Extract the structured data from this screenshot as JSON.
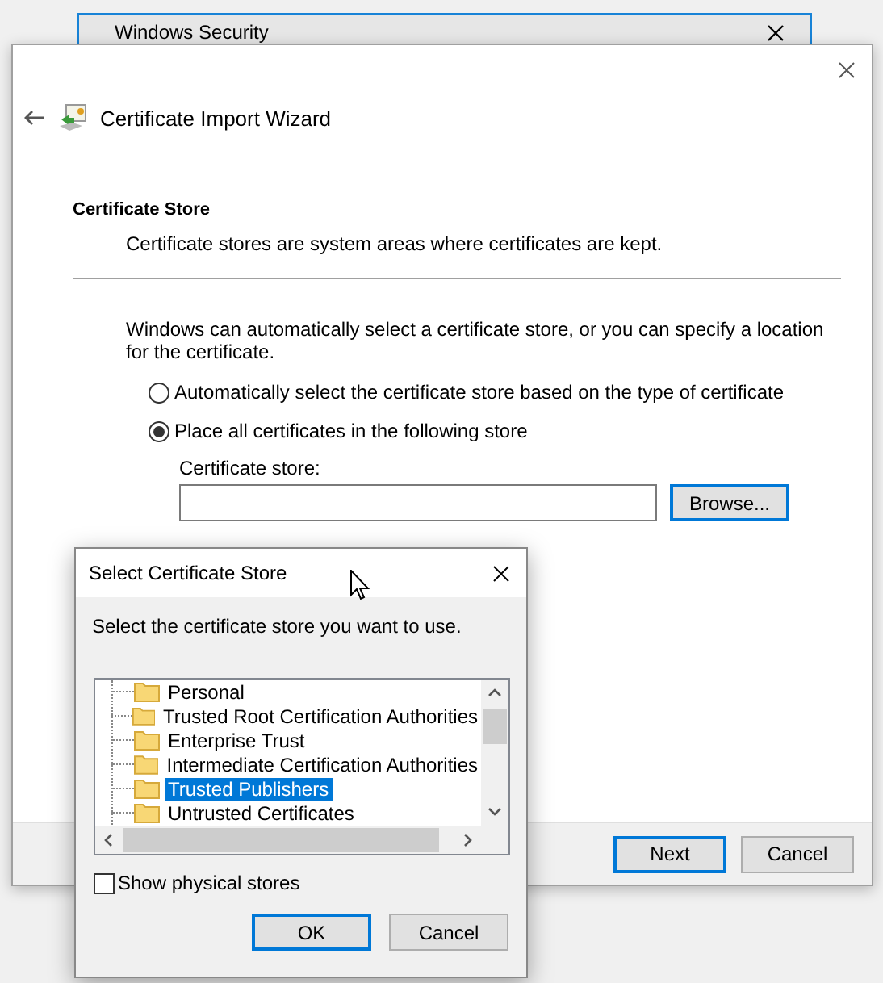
{
  "background_window": {
    "title": "Windows Security"
  },
  "wizard": {
    "title": "Certificate Import Wizard",
    "section_title": "Certificate Store",
    "section_description": "Certificate stores are system areas where certificates are kept.",
    "intro": "Windows can automatically select a certificate store, or you can specify a location for the certificate.",
    "options": [
      {
        "label": "Automatically select the certificate store based on the type of certificate",
        "selected": false
      },
      {
        "label": "Place all certificates in the following store",
        "selected": true
      }
    ],
    "store_label": "Certificate store:",
    "browse_button": "Browse...",
    "buttons": [
      {
        "label": "Next",
        "default": true
      },
      {
        "label": "Cancel",
        "default": false
      }
    ]
  },
  "dialog": {
    "title": "Select Certificate Store",
    "prompt": "Select the certificate store you want to use.",
    "stores": [
      {
        "label": "Personal",
        "selected": false
      },
      {
        "label": "Trusted Root Certification Authorities",
        "selected": false
      },
      {
        "label": "Enterprise Trust",
        "selected": false
      },
      {
        "label": "Intermediate Certification Authorities",
        "selected": false
      },
      {
        "label": "Trusted Publishers",
        "selected": true
      },
      {
        "label": "Untrusted Certificates",
        "selected": false
      }
    ],
    "show_physical_stores": {
      "label": "Show physical stores",
      "checked": false
    },
    "buttons": [
      {
        "label": "OK",
        "default": true
      },
      {
        "label": "Cancel",
        "default": false
      }
    ]
  }
}
